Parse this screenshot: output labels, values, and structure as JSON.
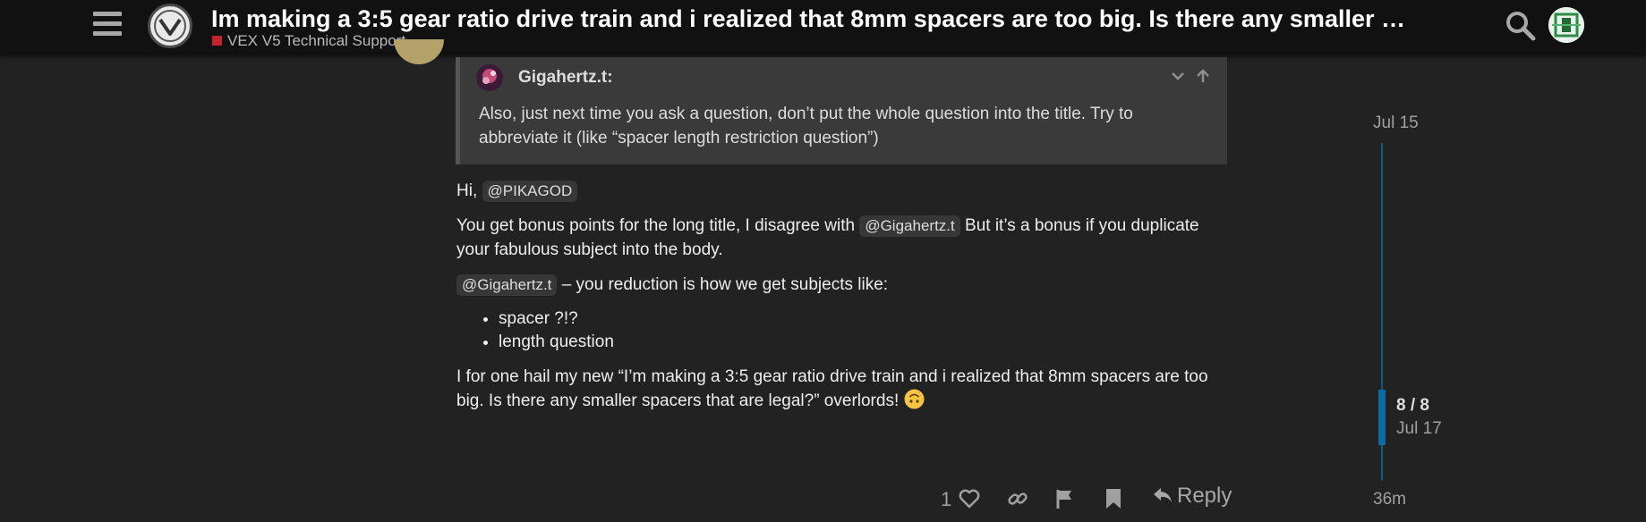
{
  "header": {
    "topic_title": "Im making a 3:5 gear ratio drive train and i realized that 8mm spacers are too big. Is there any smaller …",
    "category": "VEX V5 Technical Support",
    "category_color": "#c4232c"
  },
  "quote": {
    "username": "Gigahertz.t:",
    "text": "Also, just next time you ask a question, don’t put the whole question into the title. Try to abbreviate it (like “spacer length restriction question”)"
  },
  "post": {
    "greeting": "Hi,",
    "greeting_mention": "@PIKAGOD",
    "p2_a": "You get bonus points for the long title, I disagree with",
    "p2_mention": "@Gigahertz.t",
    "p2_b": "But it’s a bonus if you duplicate your fabulous subject into the body.",
    "p3_mention": "@Gigahertz.t",
    "p3_text": "– you reduction is how we get subjects like:",
    "list": [
      "spacer ?!?",
      "length question"
    ],
    "p4": "I for one hail my new “I’m making a 3:5 gear ratio drive train and i realized that 8mm spacers are too big. Is there any smaller spacers that are legal?” overlords!"
  },
  "actions": {
    "like_count": "1",
    "reply_label": "Reply"
  },
  "timeline": {
    "date_top": "Jul 15",
    "position": "8 / 8",
    "position_date": "Jul 17",
    "date_bottom": "36m",
    "accent": "#0b6ca0"
  },
  "icons": [
    "hamburger-icon",
    "site-logo",
    "search-icon",
    "user-avatar",
    "chevron-down-icon",
    "arrow-up-icon",
    "heart-icon",
    "link-icon",
    "flag-icon",
    "bookmark-icon",
    "reply-icon",
    "upside-down-face-emoji"
  ]
}
